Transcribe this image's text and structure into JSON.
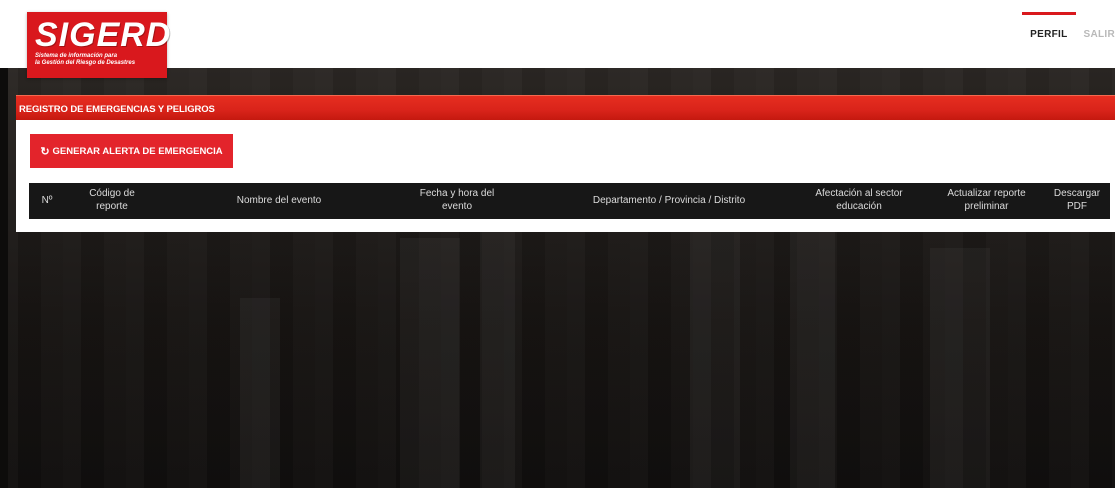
{
  "header": {
    "logo_title": "SIGERD",
    "logo_subtitle_1": "Sistema de información para",
    "logo_subtitle_2": "la Gestión del Riesgo de Desastres",
    "nav": [
      {
        "label": "PERFIL"
      },
      {
        "label": "SALIR"
      }
    ]
  },
  "panel": {
    "title": "REGISTRO DE EMERGENCIAS Y PELIGROS",
    "alert_button": {
      "icon": "refresh-icon",
      "label": "GENERAR ALERTA DE EMERGENCIA"
    },
    "table": {
      "columns": [
        "Nº",
        "Código de reporte",
        "Nombre del evento",
        "Fecha y hora del evento",
        "Departamento / Provincia / Distrito",
        "Afectación al sector educación",
        "Actualizar reporte preliminar",
        "Descargar PDF"
      ],
      "rows": []
    }
  },
  "colors": {
    "brand_red": "#d9181d",
    "table_header": "#171717",
    "background_dark": "#1a1816"
  }
}
